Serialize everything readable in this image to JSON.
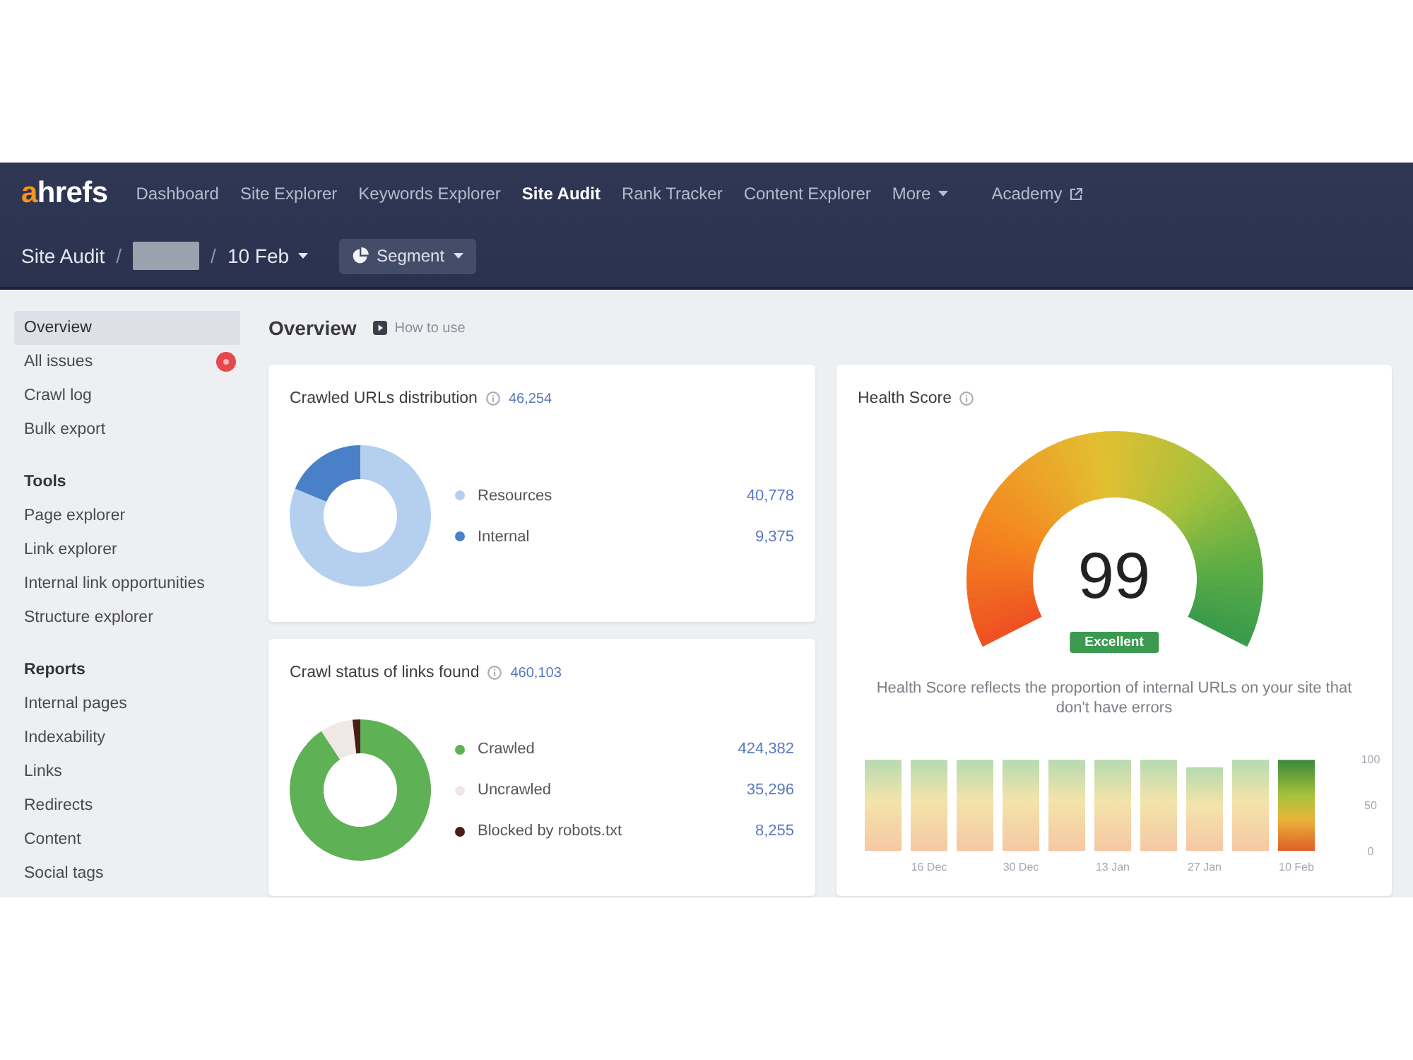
{
  "logo": "ahrefs",
  "nav": {
    "items": [
      {
        "label": "Dashboard",
        "kind": "link",
        "selected": false
      },
      {
        "label": "Site Explorer",
        "kind": "link",
        "selected": false
      },
      {
        "label": "Keywords Explorer",
        "kind": "link",
        "selected": false
      },
      {
        "label": "Site Audit",
        "kind": "link",
        "selected": true
      },
      {
        "label": "Rank Tracker",
        "kind": "link",
        "selected": false
      },
      {
        "label": "Content Explorer",
        "kind": "link",
        "selected": false
      },
      {
        "label": "More",
        "kind": "dropdown",
        "selected": false
      },
      {
        "label": "Academy",
        "kind": "external",
        "selected": false
      }
    ]
  },
  "breadcrumb": [
    {
      "kind": "text",
      "label": "Site Audit"
    },
    {
      "kind": "separator",
      "label": "/"
    },
    {
      "kind": "redacted"
    },
    {
      "kind": "separator",
      "label": "/"
    },
    {
      "kind": "dropdown",
      "label": "10 Feb"
    }
  ],
  "segment_button": {
    "label": "Segment"
  },
  "sidebar": {
    "sections": [
      {
        "items": [
          {
            "label": "Overview",
            "selected": true,
            "alert": false
          },
          {
            "label": "All issues",
            "selected": false,
            "alert": true
          },
          {
            "label": "Crawl log",
            "selected": false,
            "alert": false
          },
          {
            "label": "Bulk export",
            "selected": false,
            "alert": false
          }
        ]
      },
      {
        "title": "Tools",
        "items": [
          {
            "label": "Page explorer",
            "selected": false,
            "alert": false
          },
          {
            "label": "Link explorer",
            "selected": false,
            "alert": false
          },
          {
            "label": "Internal link opportunities",
            "selected": false,
            "alert": false
          },
          {
            "label": "Structure explorer",
            "selected": false,
            "alert": false
          }
        ]
      },
      {
        "title": "Reports",
        "items": [
          {
            "label": "Internal pages",
            "selected": false,
            "alert": false
          },
          {
            "label": "Indexability",
            "selected": false,
            "alert": false
          },
          {
            "label": "Links",
            "selected": false,
            "alert": false
          },
          {
            "label": "Redirects",
            "selected": false,
            "alert": false
          },
          {
            "label": "Content",
            "selected": false,
            "alert": false
          },
          {
            "label": "Social tags",
            "selected": false,
            "alert": false
          }
        ]
      }
    ]
  },
  "overview": {
    "title": "Overview",
    "help_link": "How to use"
  },
  "cards": [
    {
      "title": "Crawled URLs distribution",
      "total": "46,254",
      "legend": [
        {
          "label": "Resources",
          "value": "40,778",
          "color": "#b5d0ee"
        },
        {
          "label": "Internal",
          "value": "9,375",
          "color": "#4a80c8"
        }
      ]
    },
    {
      "title": "Crawl status of links found",
      "total": "460,103",
      "legend": [
        {
          "label": "Crawled",
          "value": "424,382",
          "color": "#5eb155"
        },
        {
          "label": "Uncrawled",
          "value": "35,296",
          "color": "#f0e8e6"
        },
        {
          "label": "Blocked by robots.txt",
          "value": "8,255",
          "color": "#4a1e18"
        }
      ]
    }
  ],
  "health": {
    "title": "Health Score",
    "score": "99",
    "rating": "Excellent",
    "description": "Health Score reflects the proportion of internal URLs on your site that don't have errors",
    "chart_data": {
      "type": "bar",
      "categories": [
        null,
        "16 Dec",
        null,
        "30 Dec",
        null,
        "13 Jan",
        null,
        "27 Jan",
        null,
        "10 Feb"
      ],
      "values": [
        99,
        99,
        99,
        99,
        99,
        99,
        99,
        91,
        99,
        99
      ],
      "ylim": [
        0,
        100
      ],
      "yticks": [
        0,
        50,
        100
      ]
    }
  }
}
